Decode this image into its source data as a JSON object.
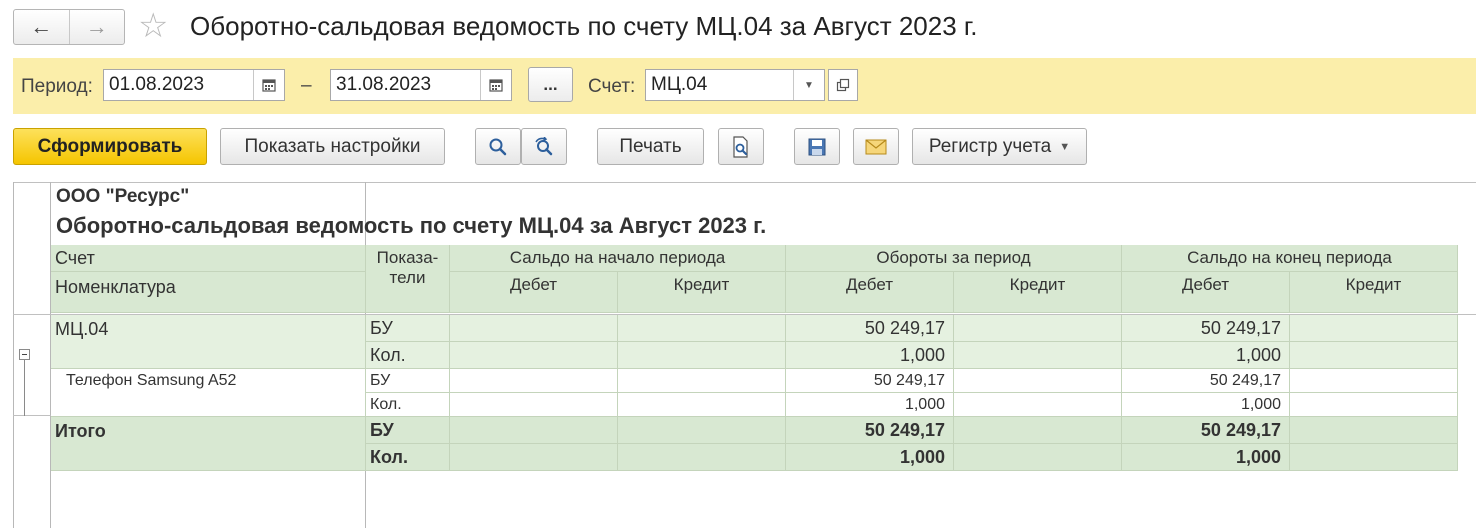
{
  "window": {
    "title": "Оборотно-сальдовая ведомость по счету МЦ.04 за Август 2023 г.",
    "back_icon": "arrow-left-icon",
    "forward_icon": "arrow-right-icon",
    "favorite_icon": "star-icon"
  },
  "params": {
    "period_label": "Период:",
    "period_start": "01.08.2023",
    "period_dash": "–",
    "period_end": "31.08.2023",
    "dots_label": "...",
    "account_label": "Счет:",
    "account_value": "МЦ.04"
  },
  "toolbar": {
    "generate": "Сформировать",
    "show_settings": "Показать настройки",
    "print": "Печать",
    "register": "Регистр учета"
  },
  "report": {
    "organization": "ООО \"Ресурс\"",
    "title": "Оборотно-сальдовая ведомость по счету МЦ.04 за Август 2023 г.",
    "headers": {
      "account": "Счет",
      "nomenclature": "Номенклатура",
      "indicators_1": "Показа-",
      "indicators_2": "тели",
      "opening_balance": "Сальдо на начало периода",
      "turnover": "Обороты за период",
      "closing_balance": "Сальдо на конец периода",
      "debit": "Дебет",
      "credit": "Кредит"
    },
    "rows": [
      {
        "name": "МЦ.04",
        "indicator": "БУ",
        "open_debit": "",
        "open_credit": "",
        "turn_debit": "50 249,17",
        "turn_credit": "",
        "close_debit": "50 249,17",
        "close_credit": ""
      },
      {
        "name": "",
        "indicator": "Кол.",
        "open_debit": "",
        "open_credit": "",
        "turn_debit": "1,000",
        "turn_credit": "",
        "close_debit": "1,000",
        "close_credit": ""
      },
      {
        "name": "Телефон Samsung A52",
        "indicator": "БУ",
        "open_debit": "",
        "open_credit": "",
        "turn_debit": "50 249,17",
        "turn_credit": "",
        "close_debit": "50 249,17",
        "close_credit": ""
      },
      {
        "name": "",
        "indicator": "Кол.",
        "open_debit": "",
        "open_credit": "",
        "turn_debit": "1,000",
        "turn_credit": "",
        "close_debit": "1,000",
        "close_credit": ""
      },
      {
        "name": "Итого",
        "indicator": "БУ",
        "open_debit": "",
        "open_credit": "",
        "turn_debit": "50 249,17",
        "turn_credit": "",
        "close_debit": "50 249,17",
        "close_credit": ""
      },
      {
        "name": "",
        "indicator": "Кол.",
        "open_debit": "",
        "open_credit": "",
        "turn_debit": "1,000",
        "turn_credit": "",
        "close_debit": "1,000",
        "close_credit": ""
      }
    ]
  },
  "colors": {
    "params_bg": "#fbeeaa",
    "header_bg": "#d8e8d2",
    "group_bg": "#e5f1e0",
    "primary_button": "#f5c500"
  }
}
